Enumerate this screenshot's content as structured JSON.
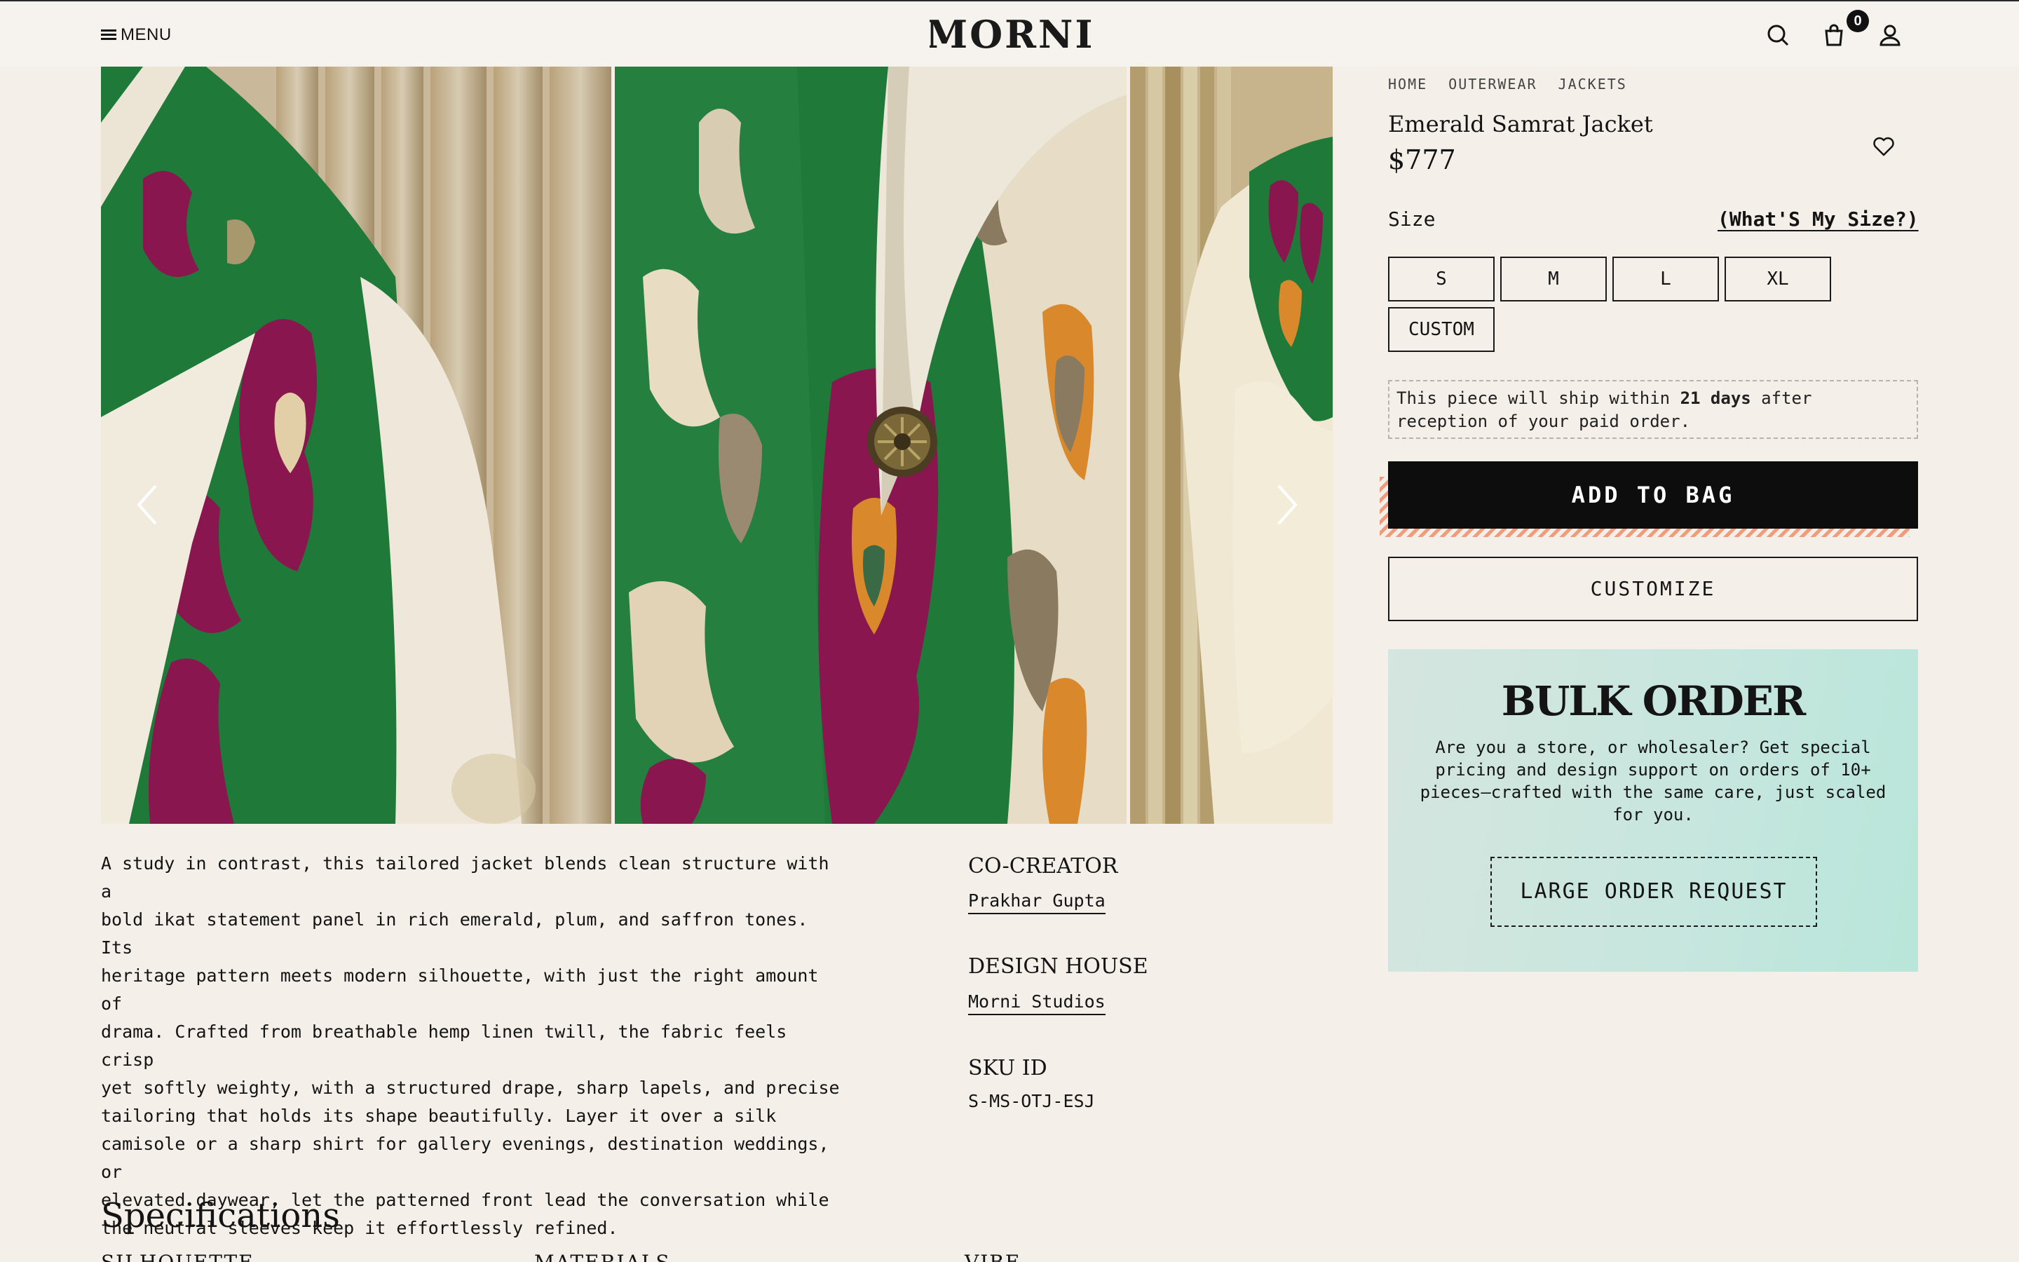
{
  "header": {
    "menu_label": "MENU",
    "logo_text": "MORNI",
    "cart_count": "0",
    "icons": [
      "search-icon",
      "bag-icon",
      "user-icon"
    ]
  },
  "gallery": {
    "dots_count": 4,
    "active_dot": 2
  },
  "breadcrumb": [
    "HOME",
    "OUTERWEAR",
    "JACKETS"
  ],
  "product": {
    "title": "Emerald Samrat Jacket",
    "price": "$777",
    "size_label": "Size",
    "size_link": "(What'S My Size?)",
    "sizes": [
      "S",
      "M",
      "L",
      "XL",
      "CUSTOM"
    ],
    "ship_prefix": "This piece will ship within ",
    "ship_days": "21 days",
    "ship_suffix": " after reception of your paid order.",
    "add_to_bag": "ADD TO BAG",
    "customize": "CUSTOMIZE"
  },
  "bulk": {
    "title": "BULK ORDER",
    "text": "Are you a store, or wholesaler? Get special pricing and design support on orders of 10+ pieces—crafted with the same care, just scaled for you.",
    "button": "LARGE ORDER REQUEST"
  },
  "description": "A study in contrast, this tailored jacket blends clean structure with a\nbold ikat statement panel in rich emerald, plum, and saffron tones. Its\nheritage pattern meets modern silhouette, with just the right amount of\ndrama. Crafted from breathable hemp linen twill, the fabric feels crisp\nyet softly weighty, with a structured drape, sharp lapels, and precise\ntailoring that holds its shape beautifully. Layer it over a silk\ncamisole or a sharp shirt for gallery evenings, destination weddings, or\nelevated daywear, let the patterned front lead the conversation while\nthe neutral sleeves keep it effortlessly refined.",
  "meta": {
    "cocreator_label": "CO-CREATOR",
    "cocreator_value": "Prakhar Gupta",
    "design_house_label": "DESIGN HOUSE",
    "design_house_value": "Morni Studios",
    "sku_label": "SKU ID",
    "sku_value": "S-MS-OTJ-ESJ"
  },
  "specifications": {
    "title": "Specifications",
    "columns": [
      "SILHOUETTE",
      "MATERIALS",
      "VIBE"
    ]
  },
  "colors": {
    "background": "#f4efe9",
    "emerald": "#1f7a3a",
    "plum": "#8a1650",
    "saffron": "#d9892c",
    "bulk_bg": "#c7e6de"
  }
}
